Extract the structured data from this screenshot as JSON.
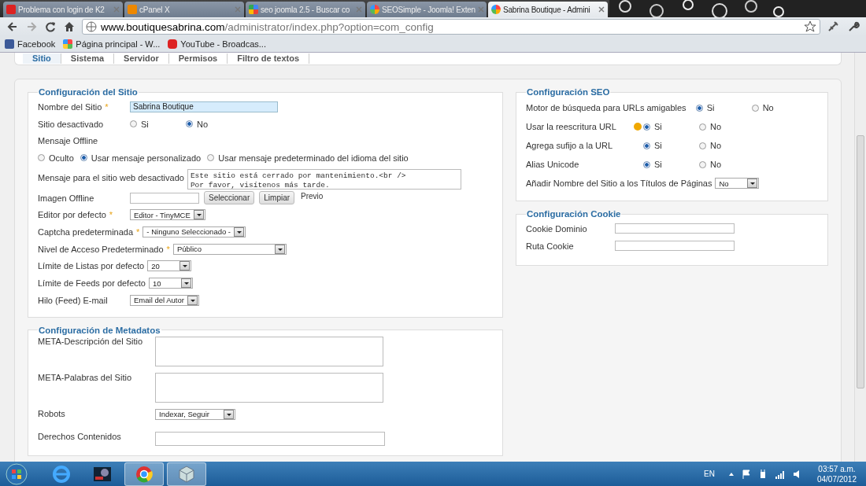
{
  "browser": {
    "tabs": [
      {
        "title": "Problema con login de K2",
        "selected": false
      },
      {
        "title": "cPanel X",
        "selected": false
      },
      {
        "title": "seo joomla 2.5 - Buscar co",
        "selected": false
      },
      {
        "title": "SEOSimple - Joomla! Exten",
        "selected": false
      },
      {
        "title": "Sabrina Boutique - Admini",
        "selected": true
      }
    ],
    "url": {
      "host": "www.boutiquesabrina.com",
      "path": "/administrator/index.php?option=com_config"
    },
    "bookmarks": [
      {
        "label": "Facebook"
      },
      {
        "label": "Página principal - W..."
      },
      {
        "label": "YouTube - Broadcas..."
      }
    ]
  },
  "subtabs": [
    {
      "label": "Sitio",
      "selected": true
    },
    {
      "label": "Sistema",
      "selected": false
    },
    {
      "label": "Servidor",
      "selected": false
    },
    {
      "label": "Permisos",
      "selected": false
    },
    {
      "label": "Filtro de textos",
      "selected": false
    }
  ],
  "site_config": {
    "title": "Configuración del Sitio",
    "fields": [
      {
        "kind": "text",
        "label": "Nombre del Sitio",
        "required": "*",
        "value": "Sabrina Boutique",
        "focused": true
      },
      {
        "kind": "radio",
        "label": "Sitio desactivado",
        "options": [
          {
            "label": "Si",
            "selected": false
          },
          {
            "label": "No",
            "selected": true
          }
        ]
      },
      {
        "kind": "radio_block",
        "label": "Mensaje Offline",
        "options": [
          {
            "label": "Oculto",
            "selected": false
          },
          {
            "label": "Usar mensaje personalizado",
            "selected": true
          },
          {
            "label": "Usar mensaje predeterminado del idioma del sitio",
            "selected": false
          }
        ]
      },
      {
        "kind": "textarea",
        "label": "Mensaje para el sitio web desactivado",
        "lines": [
          "Este sitio está cerrado por mantenimiento.<br />",
          "Por favor, visítenos más tarde."
        ]
      },
      {
        "label": "Imagen Offline",
        "buttons": [
          "Seleccionar",
          "Limpiar"
        ],
        "preview": "Previo"
      },
      {
        "kind": "select",
        "label": "Editor por defecto",
        "required": "*",
        "value": "Editor - TinyMCE"
      },
      {
        "kind": "select",
        "label": "Captcha predeterminada",
        "required": "*",
        "value": "- Ninguno Seleccionado -"
      },
      {
        "kind": "select",
        "label": "Nivel de Acceso Predeterminado",
        "required": "*",
        "value": "Público"
      },
      {
        "kind": "select",
        "label": "Límite de Listas por defecto",
        "value": "20"
      },
      {
        "kind": "select",
        "label": "Límite de Feeds por defecto",
        "value": "10"
      },
      {
        "kind": "select",
        "label": "Hilo (Feed) E-mail",
        "value": "Email del Autor"
      }
    ]
  },
  "seo": {
    "title": "Configuración SEO",
    "fields": [
      {
        "kind": "radio",
        "label": "Motor de búsqueda para URLs amigables",
        "options": [
          {
            "label": "Si",
            "selected": true
          },
          {
            "label": "No",
            "selected": false
          }
        ]
      },
      {
        "kind": "radio",
        "label": "Usar la reescritura URL",
        "warning": true,
        "options": [
          {
            "label": "Si",
            "selected": true
          },
          {
            "label": "No",
            "selected": false
          }
        ]
      },
      {
        "kind": "radio",
        "label": "Agrega sufijo a la URL",
        "options": [
          {
            "label": "Si",
            "selected": true
          },
          {
            "label": "No",
            "selected": false
          }
        ]
      },
      {
        "kind": "radio",
        "label": "Alias Unicode",
        "options": [
          {
            "label": "Si",
            "selected": true
          },
          {
            "label": "No",
            "selected": false
          }
        ]
      },
      {
        "kind": "select",
        "label": "Añadir Nombre del Sitio a los Títulos de Páginas",
        "value": "No"
      }
    ]
  },
  "cookie": {
    "title": "Configuración Cookie",
    "fields": [
      {
        "kind": "text",
        "label": "Cookie Dominio"
      },
      {
        "kind": "text",
        "label": "Ruta Cookie"
      }
    ]
  },
  "metadata": {
    "title": "Configuración de Metadatos",
    "fields": [
      {
        "kind": "textarea",
        "label": "META-Descripción del Sitio"
      },
      {
        "kind": "textarea",
        "label": "META-Palabras del Sitio"
      },
      {
        "kind": "select",
        "label": "Robots",
        "value": "Indexar, Seguir"
      },
      {
        "kind": "text",
        "label": "Derechos Contenidos"
      }
    ]
  },
  "taskbar": {
    "apps": [
      {
        "selected": false
      },
      {
        "selected": false
      },
      {
        "selected": true
      },
      {
        "selected": true
      }
    ],
    "language": "EN",
    "time": "03:57 a.m.",
    "date": "04/07/2012"
  }
}
